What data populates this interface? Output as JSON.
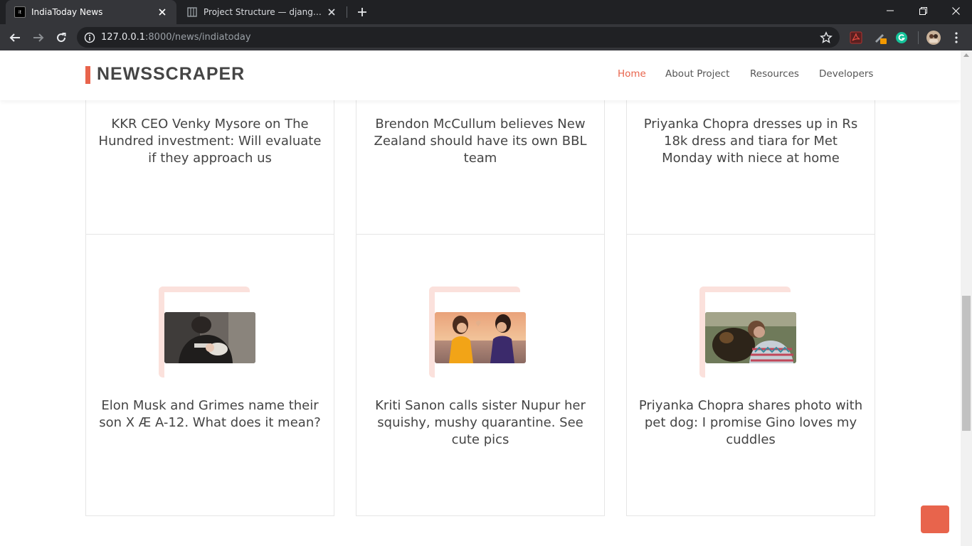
{
  "browser": {
    "tabs": [
      {
        "title": "IndiaToday News",
        "favicon_text": "it",
        "active": true
      },
      {
        "title": "Project Structure — django-project",
        "active": false
      }
    ],
    "url": {
      "host": "127.0.0.1",
      "path": ":8000/news/indiatoday"
    }
  },
  "site": {
    "logo": "NEWSSCRAPER",
    "nav": [
      "Home",
      "About Project",
      "Resources",
      "Developers"
    ],
    "active_nav": "Home",
    "accent_color": "#e8644c"
  },
  "articles": [
    {
      "title": "KKR CEO Venky Mysore on The Hundred investment: Will evaluate if they approach us"
    },
    {
      "title": "Brendon McCullum believes New Zealand should have its own BBL team"
    },
    {
      "title": "Priyanka Chopra dresses up in Rs 18k dress and tiara for Met Monday with niece at home"
    },
    {
      "title": "Elon Musk and Grimes name their son X Æ A-12. What does it mean?",
      "image": "baby-photo"
    },
    {
      "title": "Kriti Sanon calls sister Nupur her squishy, mushy quarantine. See cute pics",
      "image": "sisters-beach-photo"
    },
    {
      "title": "Priyanka Chopra shares photo with pet dog: I promise Gino loves my cuddles",
      "image": "dog-photo"
    }
  ]
}
